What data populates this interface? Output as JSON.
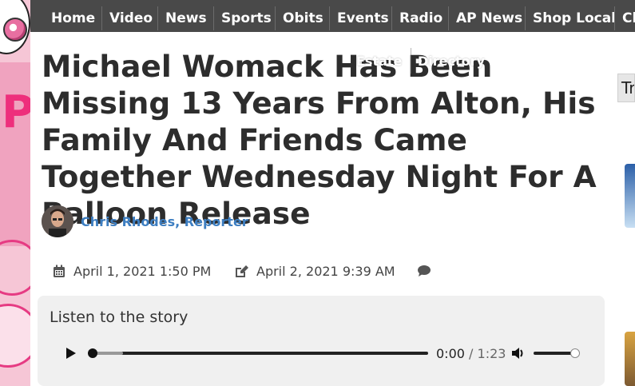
{
  "nav": {
    "items": [
      "Home",
      "Video",
      "News",
      "Sports",
      "Obits",
      "Events",
      "Radio",
      "AP News",
      "Shop Local",
      "Cl"
    ],
    "overlay_items": [
      "Estate",
      "Directory"
    ]
  },
  "article": {
    "title": "Michael Womack Has Been Missing 13 Years From Alton, His Family And Friends Came Together Wednesday Night For A Balloon Release",
    "author": "Chris Rhodes, Reporter",
    "published": "April 1, 2021 1:50 PM",
    "updated": "April 2, 2021 9:39 AM"
  },
  "player": {
    "heading": "Listen to the story",
    "current_time": "0:00",
    "separator": "/",
    "duration": "1:23"
  },
  "sidebar": {
    "tab_label": "Tr"
  },
  "colors": {
    "nav_bg": "#494949",
    "author_link": "#3d7ec1",
    "title_text": "#2d2d2d",
    "player_bg": "#f0f0f0"
  },
  "icons": [
    "calendar-icon",
    "edit-icon",
    "comment-icon",
    "play-icon",
    "volume-icon"
  ]
}
